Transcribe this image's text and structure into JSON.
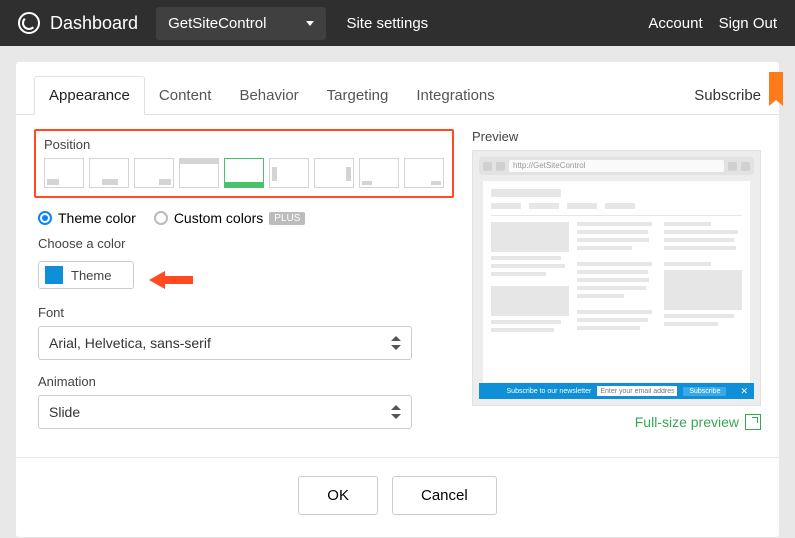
{
  "header": {
    "brand": "Dashboard",
    "siteSelect": "GetSiteControl",
    "siteSettings": "Site settings",
    "account": "Account",
    "signOut": "Sign Out"
  },
  "tabs": {
    "items": [
      "Appearance",
      "Content",
      "Behavior",
      "Targeting",
      "Integrations"
    ],
    "subscribe": "Subscribe"
  },
  "position": {
    "label": "Position"
  },
  "colorMode": {
    "theme": "Theme color",
    "custom": "Custom colors",
    "plus": "PLUS",
    "chooseLabel": "Choose a color",
    "themeBtn": "Theme"
  },
  "font": {
    "label": "Font",
    "value": "Arial, Helvetica, sans-serif"
  },
  "animation": {
    "label": "Animation",
    "value": "Slide"
  },
  "preview": {
    "label": "Preview",
    "url": "http://GetSiteControl",
    "barText": "Subscribe to our newsletter",
    "placeholder": "Enter your email address",
    "subscribeBtn": "Subscribe",
    "fullSize": "Full-size preview"
  },
  "footer": {
    "ok": "OK",
    "cancel": "Cancel"
  }
}
